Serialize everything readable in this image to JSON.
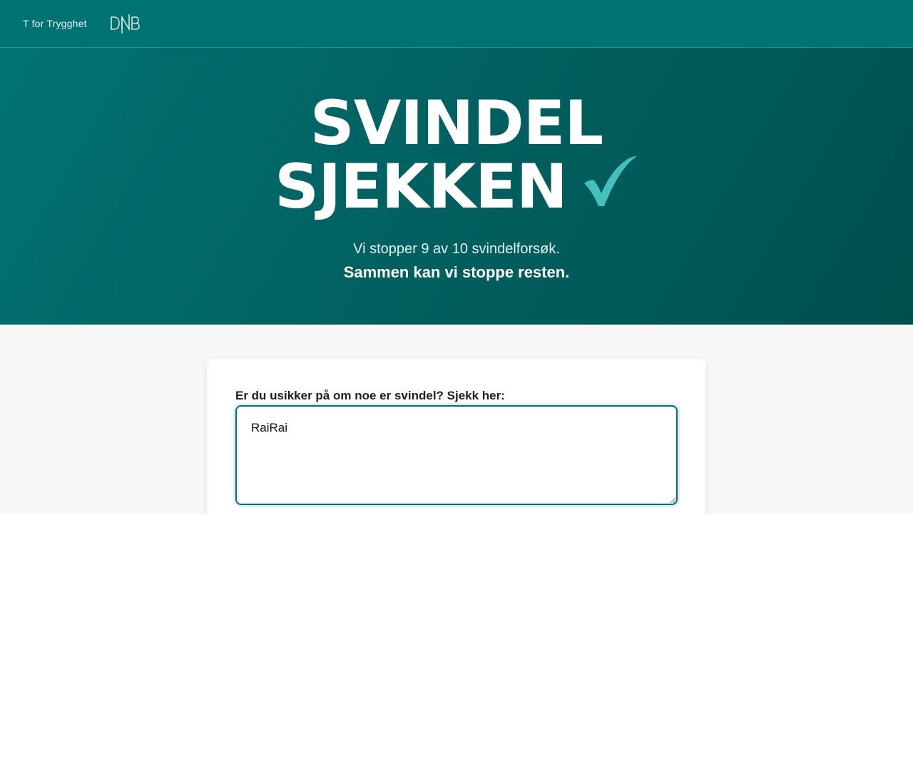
{
  "header": {
    "brand_link": "T for Trygghet",
    "logo_text": "DNB"
  },
  "hero": {
    "title_line1": "SVINDEL",
    "title_line2": "SJEKKEN",
    "check_color": "#45c1bd",
    "subtitle": "Vi stopper 9 av 10 svindelforsøk.",
    "tagline": "Sammen kan vi stoppe resten."
  },
  "form": {
    "label": "Er du usikker på om noe er svindel? Sjekk her:",
    "value": "RaiRai"
  },
  "colors": {
    "header_bg": "#007272",
    "accent": "#007272",
    "content_bg": "#f7f7f7"
  }
}
